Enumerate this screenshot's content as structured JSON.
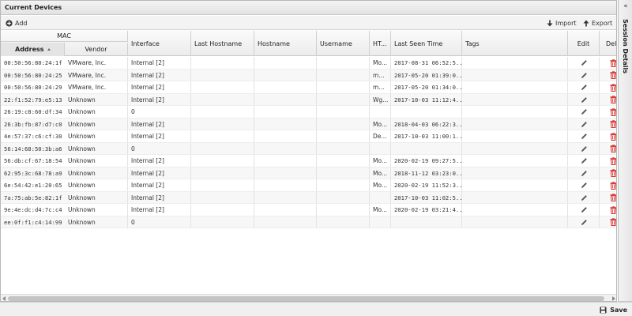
{
  "panel": {
    "title": "Current Devices"
  },
  "toolbar": {
    "add_label": "Add",
    "import_label": "Import",
    "export_label": "Export"
  },
  "header": {
    "group_mac": "MAC",
    "address": "Address",
    "vendor": "Vendor",
    "interface": "Interface",
    "last_hostname": "Last Hostname",
    "hostname": "Hostname",
    "username": "Username",
    "ht": "HT...",
    "last_seen": "Last Seen Time",
    "tags": "Tags",
    "edit": "Edit",
    "delete": "Del"
  },
  "rows": [
    {
      "address": "00:50:56:80:24:1f",
      "vendor": "VMware, Inc.",
      "interface": "Internal [2]",
      "ht": "Mo...",
      "last_seen": "2017-08-31 06:52:5..."
    },
    {
      "address": "00:50:56:80:24:25",
      "vendor": "VMware, Inc.",
      "interface": "Internal [2]",
      "ht": "m...",
      "last_seen": "2017-05-20 01:39:0..."
    },
    {
      "address": "00:50:56:80:24:29",
      "vendor": "VMware, Inc.",
      "interface": "Internal [2]",
      "ht": "m...",
      "last_seen": "2017-05-20 01:34:0..."
    },
    {
      "address": "22:f1:52:79:e5:13",
      "vendor": "Unknown",
      "interface": "Internal [2]",
      "ht": "Wg...",
      "last_seen": "2017-10-03 11:12:4..."
    },
    {
      "address": "26:19:c8:60:df:34",
      "vendor": "Unknown",
      "interface": "0",
      "ht": "",
      "last_seen": ""
    },
    {
      "address": "26:3b:fb:87:d7:c0",
      "vendor": "Unknown",
      "interface": "Internal [2]",
      "ht": "Mo...",
      "last_seen": "2018-04-03 06:22:3..."
    },
    {
      "address": "4e:57:37:c6:cf:30",
      "vendor": "Unknown",
      "interface": "Internal [2]",
      "ht": "De...",
      "last_seen": "2017-10-03 11:00:1..."
    },
    {
      "address": "56:14:68:50:3b:a6",
      "vendor": "Unknown",
      "interface": "0",
      "ht": "",
      "last_seen": ""
    },
    {
      "address": "56:db:cf:67:18:54",
      "vendor": "Unknown",
      "interface": "Internal [2]",
      "ht": "Mo...",
      "last_seen": "2020-02-19 09:27:5..."
    },
    {
      "address": "62:95:3c:68:78:a9",
      "vendor": "Unknown",
      "interface": "Internal [2]",
      "ht": "Mo...",
      "last_seen": "2018-11-12 03:23:0..."
    },
    {
      "address": "6e:54:42:e1:20:65",
      "vendor": "Unknown",
      "interface": "Internal [2]",
      "ht": "Mo...",
      "last_seen": "2020-02-19 11:52:3..."
    },
    {
      "address": "7a:75:ab:5e:82:1f",
      "vendor": "Unknown",
      "interface": "Internal [2]",
      "ht": "",
      "last_seen": "2017-10-03 11:02:5..."
    },
    {
      "address": "9e:4e:dc:d4:7c:c4",
      "vendor": "Unknown",
      "interface": "Internal [2]",
      "ht": "Mo...",
      "last_seen": "2020-02-19 03:21:4..."
    },
    {
      "address": "ee:0f:f1:c4:14:99",
      "vendor": "Unknown",
      "interface": "0",
      "ht": "",
      "last_seen": ""
    }
  ],
  "side_panel": {
    "title": "Session Details"
  },
  "footer": {
    "save_label": "Save"
  },
  "colors": {
    "delete_icon": "#d9312b",
    "edit_icon": "#555555",
    "accent": "#333333"
  },
  "icons": {
    "add": "add-circle-icon",
    "import": "arrow-down-icon",
    "export": "arrow-up-icon",
    "edit": "pencil-icon",
    "delete": "trash-icon",
    "save": "floppy-disk-icon",
    "collapse": "double-chevron-left-icon"
  }
}
